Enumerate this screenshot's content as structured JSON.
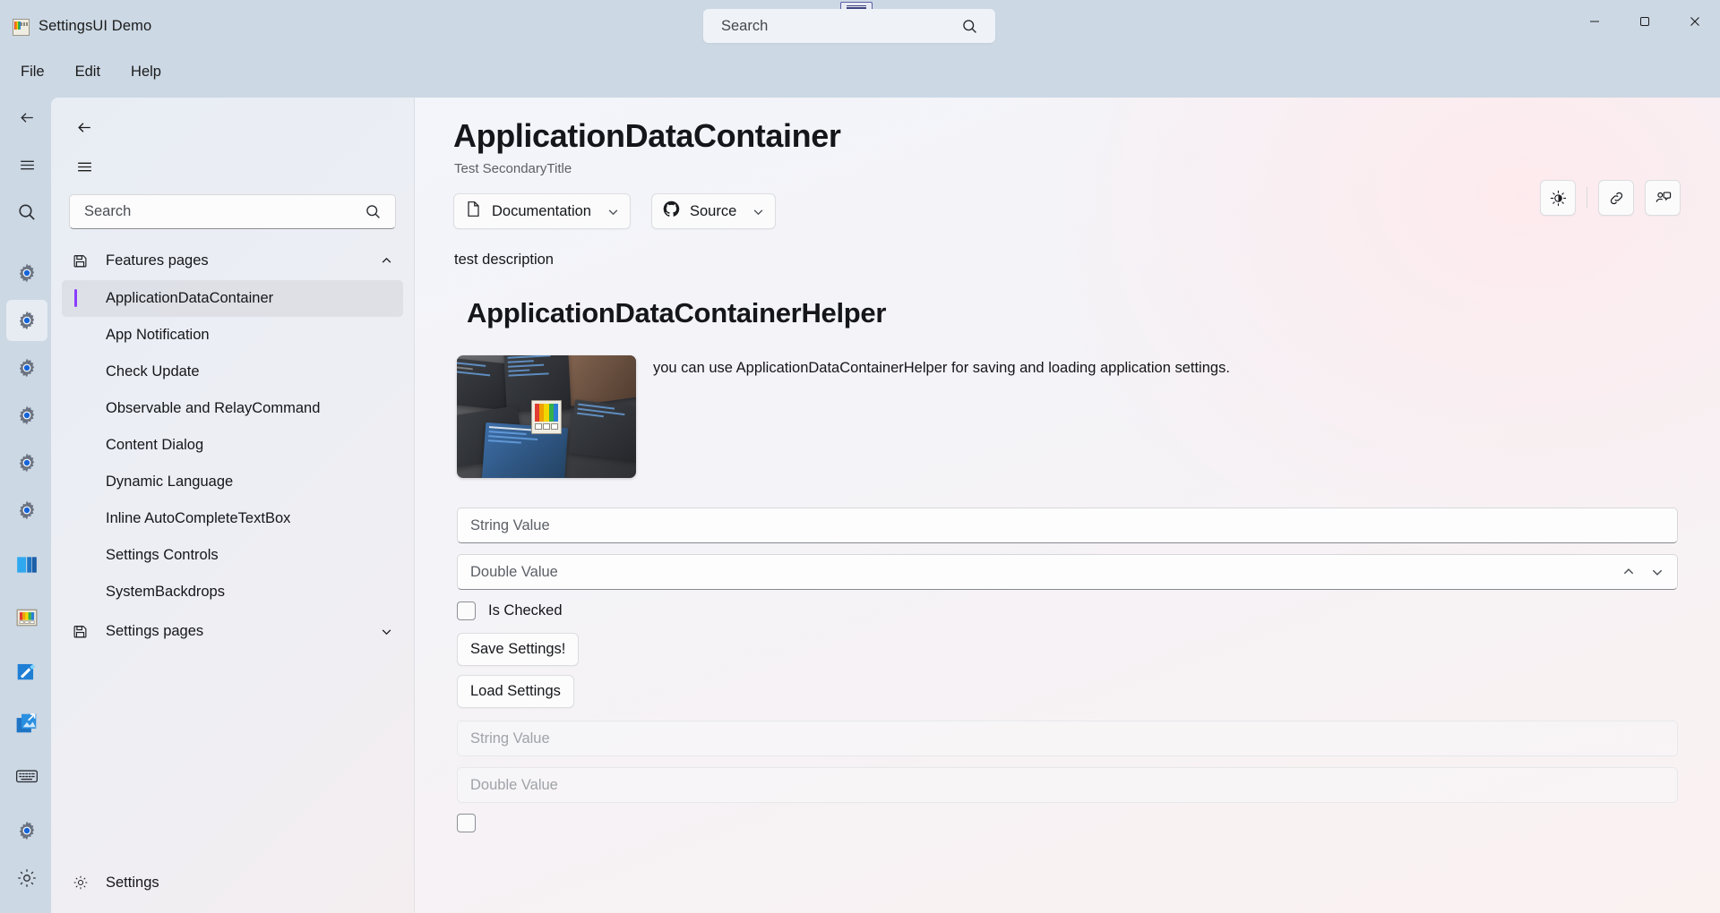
{
  "window": {
    "app_title": "SettingsUI Demo",
    "minimize_label": "Minimize",
    "maximize_label": "Maximize",
    "close_label": "Close"
  },
  "top_search": {
    "placeholder": "Search",
    "value": "Search"
  },
  "menubar": {
    "items": [
      {
        "label": "File"
      },
      {
        "label": "Edit"
      },
      {
        "label": "Help"
      }
    ]
  },
  "rail": {
    "items": [
      {
        "name": "back",
        "icon": "back-arrow-icon"
      },
      {
        "name": "menu",
        "icon": "hamburger-icon"
      },
      {
        "name": "search",
        "icon": "search-icon"
      },
      {
        "name": "settings-1",
        "icon": "gear-icon"
      },
      {
        "name": "settings-2",
        "icon": "gear-icon",
        "selected": true
      },
      {
        "name": "settings-3",
        "icon": "gear-icon"
      },
      {
        "name": "settings-4",
        "icon": "gear-icon"
      },
      {
        "name": "settings-5",
        "icon": "gear-icon"
      },
      {
        "name": "settings-6",
        "icon": "gear-icon"
      },
      {
        "name": "windows-tiles",
        "icon": "windows-tiles-icon"
      },
      {
        "name": "color-palette",
        "icon": "color-palette-icon"
      },
      {
        "name": "color-picker",
        "icon": "eyedropper-icon"
      },
      {
        "name": "resize-image",
        "icon": "image-resizer-icon"
      },
      {
        "name": "keyboard",
        "icon": "keyboard-icon"
      }
    ],
    "bottom": [
      {
        "name": "settings",
        "icon": "gear-icon"
      },
      {
        "name": "about",
        "icon": "gear-icon"
      }
    ]
  },
  "navpane": {
    "back_label": "Back",
    "menu_label": "Menu",
    "search": {
      "placeholder": "Search",
      "value": "Search"
    },
    "groups": [
      {
        "label": "Features pages",
        "icon": "save-icon",
        "expanded": true,
        "chevron": "chevron-up-icon",
        "items": [
          {
            "label": "ApplicationDataContainer",
            "active": true
          },
          {
            "label": "App Notification",
            "active": false
          },
          {
            "label": "Check Update",
            "active": false
          },
          {
            "label": "Observable and RelayCommand",
            "active": false
          },
          {
            "label": "Content Dialog",
            "active": false
          },
          {
            "label": "Dynamic Language",
            "active": false
          },
          {
            "label": "Inline AutoCompleteTextBox",
            "active": false
          },
          {
            "label": "Settings Controls",
            "active": false
          },
          {
            "label": "SystemBackdrops",
            "active": false
          }
        ]
      },
      {
        "label": "Settings pages",
        "icon": "save-icon",
        "expanded": false,
        "chevron": "chevron-down-icon",
        "items": []
      }
    ],
    "footer": {
      "label": "Settings",
      "icon": "gear-icon"
    }
  },
  "page": {
    "title": "ApplicationDataContainer",
    "subtitle": "Test SecondaryTitle",
    "description": "test description",
    "header_buttons": [
      {
        "label": "Documentation",
        "icon": "document-icon",
        "chevron": "chevron-down-icon"
      },
      {
        "label": "Source",
        "icon": "github-icon",
        "chevron": "chevron-down-icon"
      }
    ],
    "header_actions": [
      {
        "name": "theme-toggle",
        "icon": "brightness-icon"
      },
      {
        "name": "copy-link",
        "icon": "link-icon"
      },
      {
        "name": "send-feedback",
        "icon": "feedback-icon"
      }
    ]
  },
  "card": {
    "title": "ApplicationDataContainerHelper",
    "description": "you can use ApplicationDataContainerHelper for saving and loading application settings.",
    "thumbnail_alt": "desktop-screenshot-collage",
    "fields": [
      {
        "name": "string-value-input",
        "placeholder": "String Value",
        "value": "",
        "disabled": false,
        "kind": "text"
      },
      {
        "name": "double-value-input",
        "placeholder": "Double Value",
        "value": "",
        "disabled": false,
        "kind": "number"
      }
    ],
    "checkbox": {
      "label": "Is Checked",
      "checked": false
    },
    "buttons": [
      {
        "label": "Save Settings!",
        "name": "save-settings-button"
      },
      {
        "label": "Load Settings",
        "name": "load-settings-button"
      }
    ],
    "readonly_fields": [
      {
        "name": "string-value-readonly",
        "placeholder": "String Value",
        "value": "",
        "disabled": true,
        "kind": "text"
      },
      {
        "name": "double-value-readonly",
        "placeholder": "Double Value",
        "value": "",
        "disabled": true,
        "kind": "text"
      }
    ],
    "readonly_checkbox": {
      "label": "",
      "checked": false
    }
  },
  "colors": {
    "accent": "#8b3dff",
    "titlebar_bg": "#ccd8e4",
    "content_bg": "#f4f3f7",
    "nav_bg": "#eceef4"
  }
}
